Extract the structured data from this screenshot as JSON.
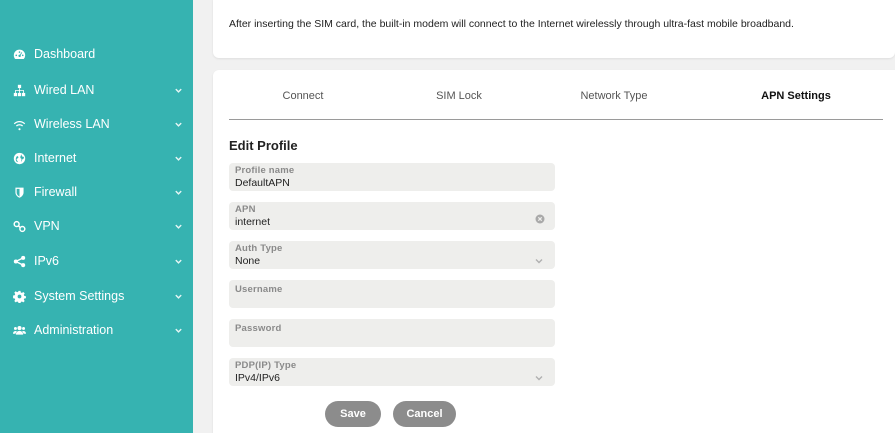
{
  "colors": {
    "sidebar_bg": "#36b3b1",
    "button_bg": "#8c8c8c",
    "field_bg": "#eeeeec"
  },
  "sidebar": {
    "items": [
      {
        "label": "Dashboard",
        "icon": "dashboard-icon",
        "has_chevron": false
      },
      {
        "label": "Wired LAN",
        "icon": "sitemap-icon",
        "has_chevron": true
      },
      {
        "label": "Wireless LAN",
        "icon": "wifi-icon",
        "has_chevron": true
      },
      {
        "label": "Internet",
        "icon": "globe-icon",
        "has_chevron": true
      },
      {
        "label": "Firewall",
        "icon": "shield-icon",
        "has_chevron": true
      },
      {
        "label": "VPN",
        "icon": "key-icon",
        "has_chevron": true
      },
      {
        "label": "IPv6",
        "icon": "share-icon",
        "has_chevron": true
      },
      {
        "label": "System Settings",
        "icon": "gear-icon",
        "has_chevron": true
      },
      {
        "label": "Administration",
        "icon": "users-icon",
        "has_chevron": true
      }
    ]
  },
  "info": {
    "text": "After inserting the SIM card, the built-in modem will connect to the Internet wirelessly through ultra-fast mobile broadband."
  },
  "tabs": [
    {
      "label": "Connect",
      "active": false
    },
    {
      "label": "SIM Lock",
      "active": false
    },
    {
      "label": "Network Type",
      "active": false
    },
    {
      "label": "APN Settings",
      "active": true
    }
  ],
  "form": {
    "title": "Edit Profile",
    "profile_name": {
      "label": "Profile name",
      "value": "DefaultAPN"
    },
    "apn": {
      "label": "APN",
      "value": "internet"
    },
    "auth_type": {
      "label": "Auth Type",
      "value": "None"
    },
    "username": {
      "label": "Username",
      "value": ""
    },
    "password": {
      "label": "Password",
      "value": ""
    },
    "pdp_type": {
      "label": "PDP(IP) Type",
      "value": "IPv4/IPv6"
    }
  },
  "buttons": {
    "save": "Save",
    "cancel": "Cancel"
  }
}
